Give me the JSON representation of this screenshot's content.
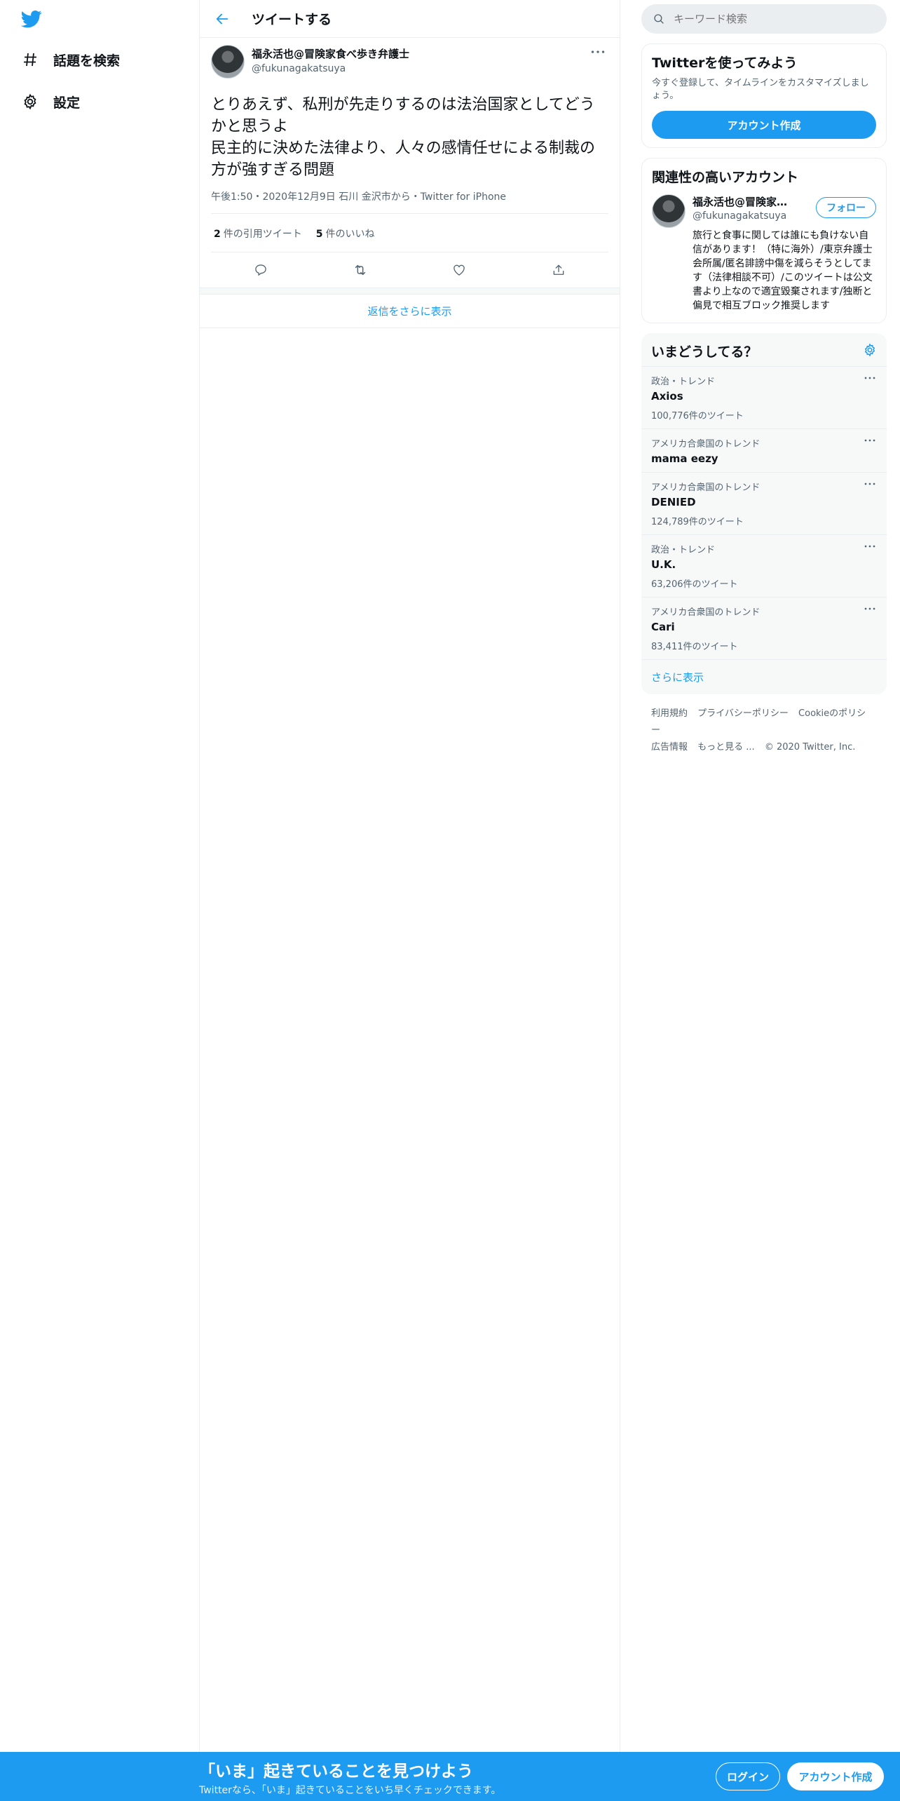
{
  "nav": {
    "logo": "twitter-bird-icon",
    "items": [
      {
        "icon": "hashtag-icon",
        "label": "話題を検索"
      },
      {
        "icon": "gear-icon",
        "label": "設定"
      }
    ]
  },
  "header": {
    "title": "ツイートする"
  },
  "tweet": {
    "display_name": "福永活也@冒険家食べ歩き弁護士",
    "handle": "@fukunagakatsuya",
    "text": "とりあえず、私刑が先走りするのは法治国家としてどうかと思うよ\n民主的に決めた法律より、人々の感情任せによる制裁の方が強すぎる問題",
    "meta": "午後1:50・2020年12月9日 石川 金沢市から・Twitter for iPhone",
    "quote_count": "2",
    "quote_label": "件の引用ツイート",
    "like_count": "5",
    "like_label": "件のいいね"
  },
  "replies": {
    "show_more": "返信をさらに表示"
  },
  "search": {
    "placeholder": "キーワード検索"
  },
  "signup": {
    "title": "Twitterを使ってみよう",
    "subtitle": "今すぐ登録して、タイムラインをカスタマイズしましょう。",
    "button": "アカウント作成"
  },
  "related": {
    "title": "関連性の高いアカウント",
    "name": "福永活也@冒険家食...",
    "handle": "@fukunagakatsuya",
    "follow": "フォロー",
    "bio": "旅行と食事に関しては誰にも負けない自信があります！（特に海外）/東京弁護士会所属/匿名誹謗中傷を減らそうとしてます（法律相談不可）/このツイートは公文書より上なので適宜毀棄されます/独断と偏見で相互ブロック推奨します"
  },
  "trends": {
    "title": "いまどうしてる？",
    "items": [
      {
        "context": "政治・トレンド",
        "name": "Axios",
        "count": "100,776件のツイート"
      },
      {
        "context": "アメリカ合衆国のトレンド",
        "name": "mama eezy",
        "count": ""
      },
      {
        "context": "アメリカ合衆国のトレンド",
        "name": "DENIED",
        "count": "124,789件のツイート"
      },
      {
        "context": "政治・トレンド",
        "name": "U.K.",
        "count": "63,206件のツイート"
      },
      {
        "context": "アメリカ合衆国のトレンド",
        "name": "Cari",
        "count": "83,411件のツイート"
      }
    ],
    "show_more": "さらに表示"
  },
  "footer": {
    "links": [
      "利用規約",
      "プライバシーポリシー",
      "Cookieのポリシー",
      "広告情報",
      "もっと見る ..."
    ],
    "copyright": "© 2020 Twitter, Inc."
  },
  "banner": {
    "title": "「いま」起きていることを見つけよう",
    "subtitle": "Twitterなら、「いま」起きていることをいち早くチェックできます。",
    "login": "ログイン",
    "signup": "アカウント作成"
  },
  "colors": {
    "accent": "#1d9bf0",
    "text": "#0f1419",
    "muted": "#536471",
    "border": "#ebeef0"
  }
}
